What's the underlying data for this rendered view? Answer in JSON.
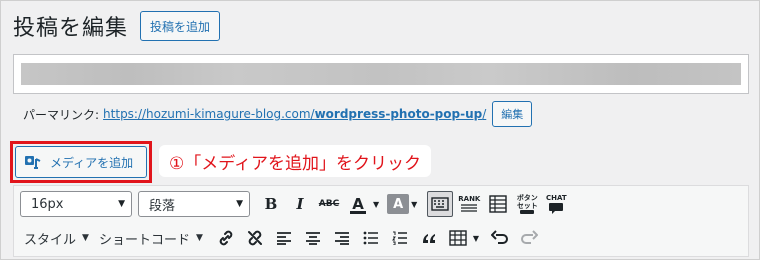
{
  "header": {
    "title": "投稿を編集",
    "add_post_button": "投稿を追加"
  },
  "permalink": {
    "label": "パーマリンク:",
    "url_prefix": "https://hozumi-kimagure-blog.com/",
    "url_slug": "wordpress-photo-pop-up",
    "url_suffix": "/",
    "edit_button": "編集"
  },
  "media": {
    "add_media_button": "メディアを追加"
  },
  "annotation": {
    "text": "①「メディアを追加」をクリック",
    "color": "#e1141b"
  },
  "toolbar": {
    "font_size": "16px",
    "block_format": "段落",
    "style_menu": "スタイル",
    "shortcode_menu": "ショートコード",
    "bold": "B",
    "italic": "I",
    "strike": "ABC",
    "text_color": "A",
    "bg_color": "A",
    "rank_label": "RANK",
    "button_label_line1": "ボタン",
    "button_label_line2": "セット",
    "chat_label": "CHAT"
  },
  "colors": {
    "accent": "#2271b1",
    "highlight_border": "#e1141b",
    "background": "#f0f0f1"
  }
}
